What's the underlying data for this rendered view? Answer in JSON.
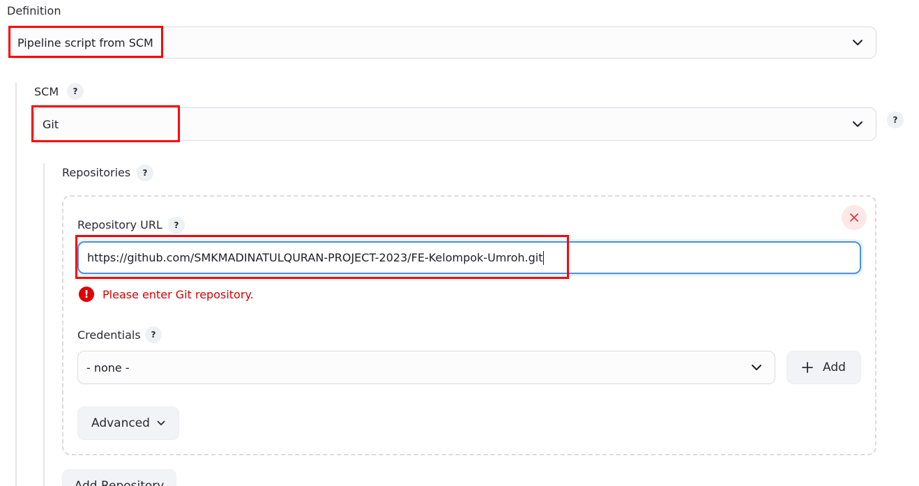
{
  "definition": {
    "label": "Definition",
    "selected": "Pipeline script from SCM"
  },
  "scm": {
    "label": "SCM",
    "help": "?",
    "selected": "Git",
    "side_help": "?"
  },
  "repositories": {
    "label": "Repositories",
    "help": "?",
    "repository_url": {
      "label": "Repository URL",
      "help": "?",
      "value": "https://github.com/SMKMADINATULQURAN-PROJECT-2023/FE-Kelompok-Umroh.git",
      "error_icon": "!",
      "error": "Please enter Git repository."
    },
    "credentials": {
      "label": "Credentials",
      "help": "?",
      "selected": "- none -",
      "add_label": "Add"
    },
    "advanced_label": "Advanced",
    "add_repository_label": "Add Repository"
  },
  "colors": {
    "highlight": "#ff0000",
    "error": "#d40000",
    "focus": "#4a90e2"
  }
}
